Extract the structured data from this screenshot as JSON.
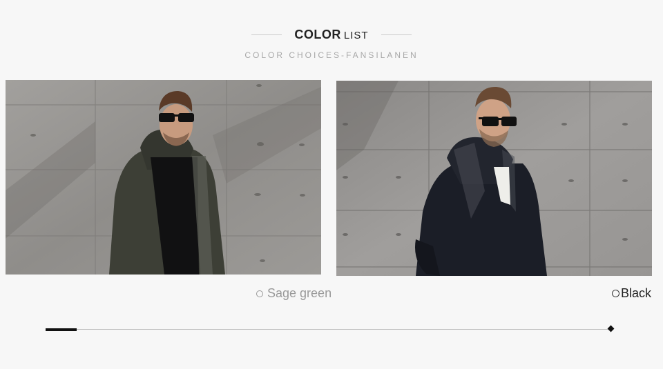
{
  "header": {
    "title_bold": "COLOR",
    "title_light": "LIST",
    "subtitle": "COLOR CHOICES-FANSILANEN"
  },
  "colors": [
    {
      "label": "Sage green",
      "swatch": "#5b5e52"
    },
    {
      "label": "Black",
      "swatch": "#1b1e27"
    }
  ],
  "slider": {
    "progress": 0.055
  }
}
